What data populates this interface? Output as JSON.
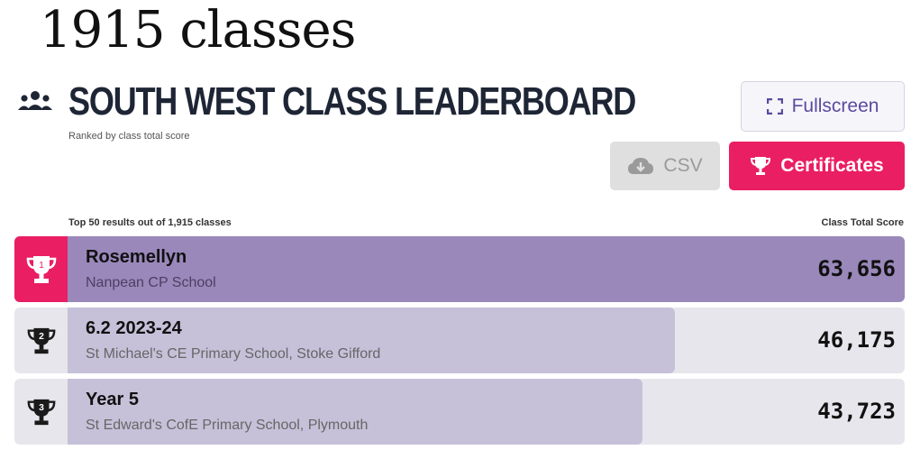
{
  "caption": "1915 classes",
  "header": {
    "icon": "group-icon",
    "title": "SOUTH WEST CLASS LEADERBOARD",
    "subtitle": "Ranked by class total score"
  },
  "toolbar": {
    "fullscreen_label": "Fullscreen",
    "fullscreen_icon": "expand-icon",
    "csv_label": "CSV",
    "csv_icon": "cloud-download-icon",
    "certificates_label": "Certificates",
    "certificates_icon": "trophy-icon"
  },
  "results": {
    "summary": "Top 50 results out of 1,915 classes",
    "score_header": "Class Total Score"
  },
  "colors": {
    "accent_pink": "#ea1e63",
    "first_bar": "#9a88bb",
    "bar": "#c6c1d9",
    "title": "#1e2535"
  },
  "leaderboard": [
    {
      "rank": "1",
      "class_name": "Rosemellyn",
      "school": "Nanpean CP School",
      "score": "63,656",
      "score_value": 63656
    },
    {
      "rank": "2",
      "class_name": "6.2 2023-24",
      "school": "St Michael's CE Primary School, Stoke Gifford",
      "score": "46,175",
      "score_value": 46175
    },
    {
      "rank": "3",
      "class_name": "Year 5",
      "school": "St Edward's CofE Primary School, Plymouth",
      "score": "43,723",
      "score_value": 43723
    }
  ]
}
